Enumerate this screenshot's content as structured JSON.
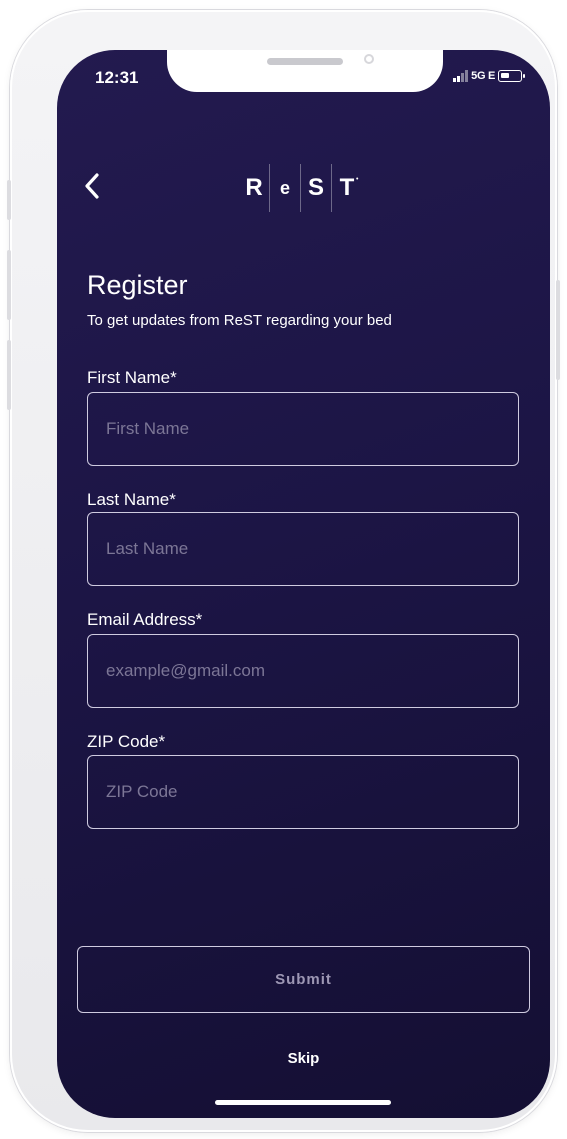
{
  "status_bar": {
    "time": "12:31",
    "network": "5G E"
  },
  "header": {
    "back_icon": "chevron-left-icon",
    "logo_letters": [
      "R",
      "e",
      "S",
      "T"
    ]
  },
  "form": {
    "title": "Register",
    "subtitle": "To get updates from ReST regarding your bed",
    "fields": [
      {
        "label": "First Name*",
        "placeholder": "First Name",
        "value": ""
      },
      {
        "label": "Last Name*",
        "placeholder": "Last Name",
        "value": ""
      },
      {
        "label": "Email Address*",
        "placeholder": "example@gmail.com",
        "value": ""
      },
      {
        "label": "ZIP Code*",
        "placeholder": "ZIP Code",
        "value": ""
      }
    ],
    "submit_label": "Submit",
    "skip_label": "Skip"
  },
  "colors": {
    "background": "#1c1545",
    "text": "#ffffff",
    "border": "#cfcbe0",
    "placeholder": "#7c7696"
  }
}
